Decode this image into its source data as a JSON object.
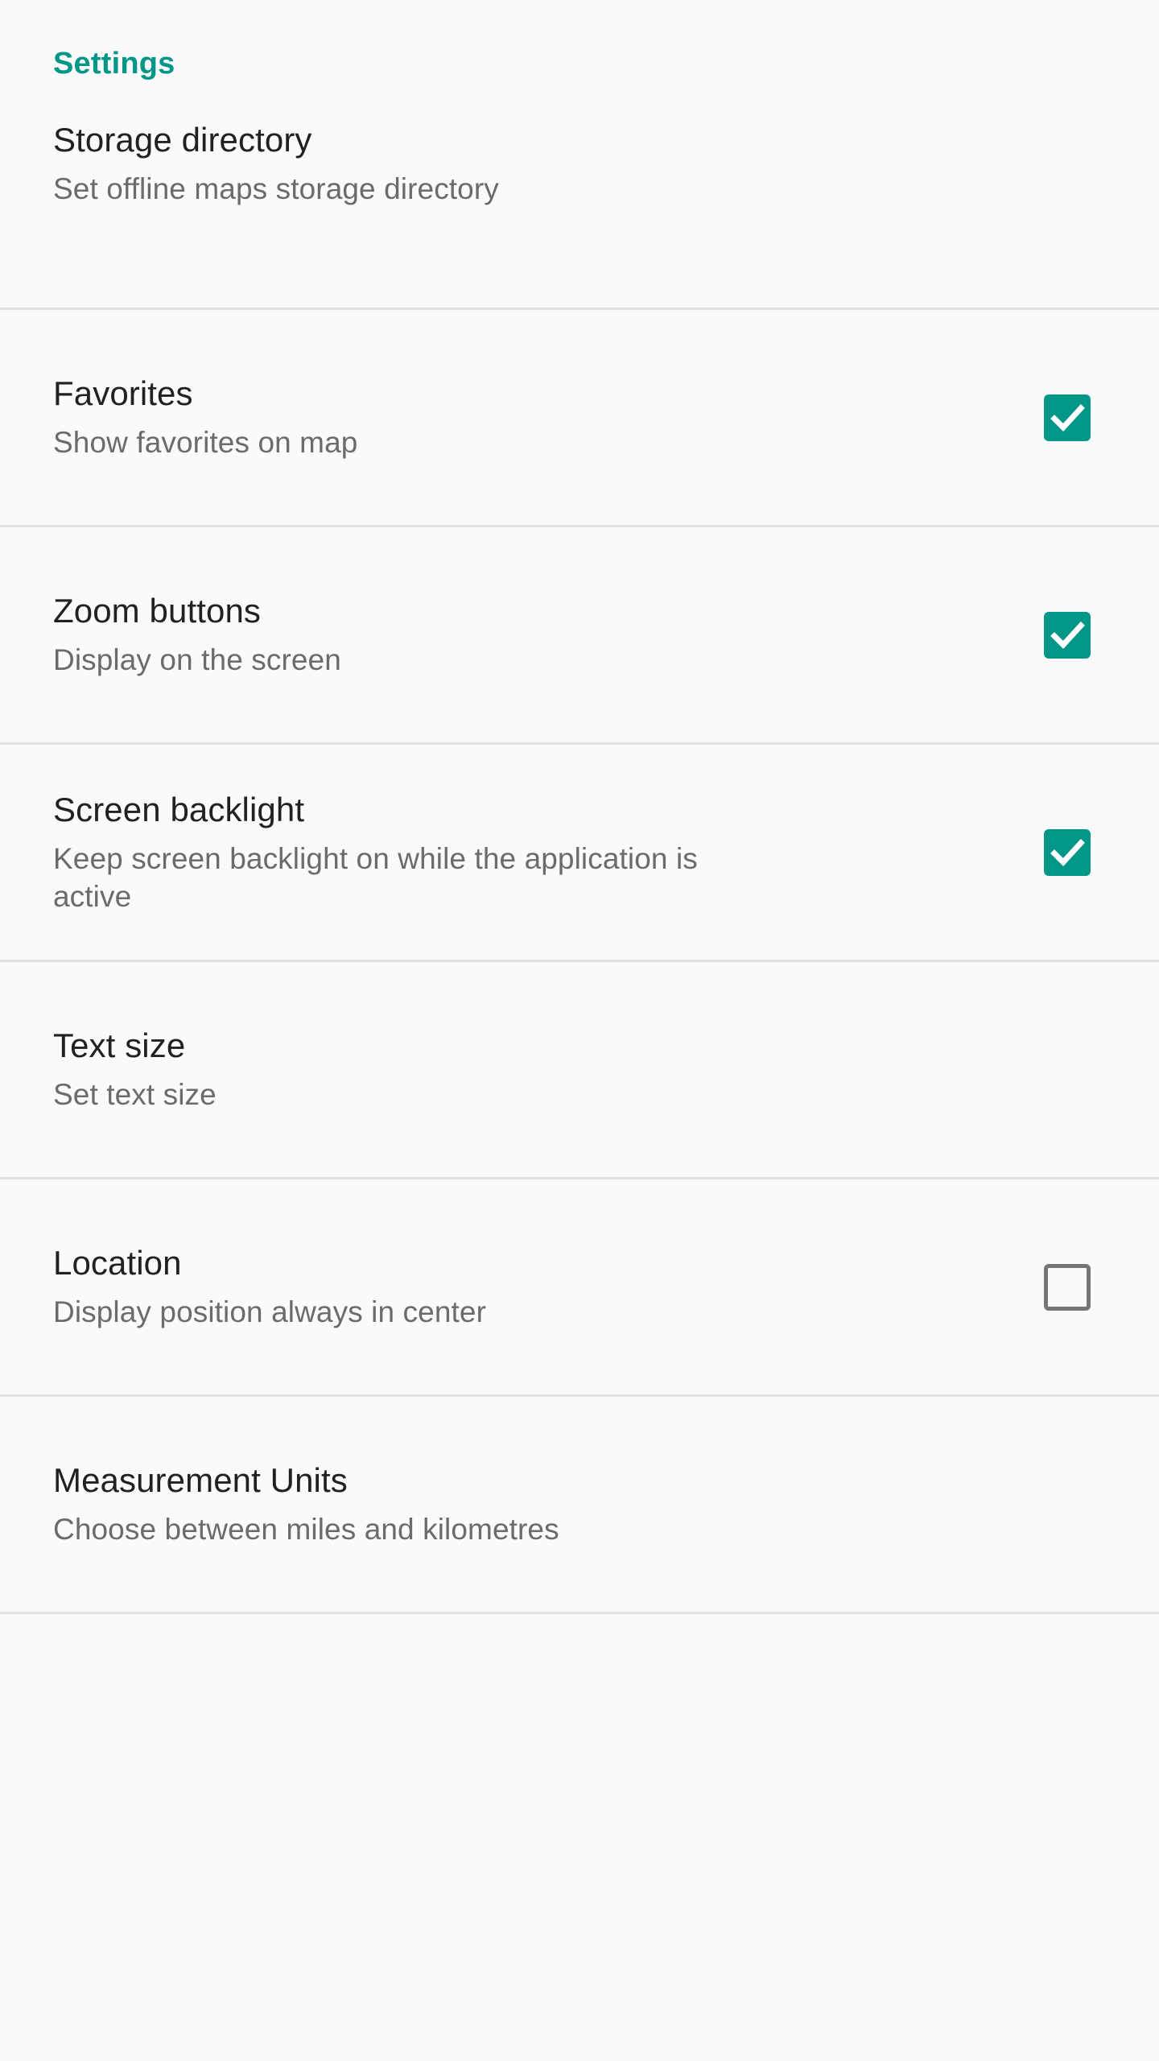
{
  "theme": {
    "accent_color": "#009688",
    "background_color": "#fafafa",
    "title_color": "#212121",
    "summary_color": "#6b6b6b",
    "divider_color": "#e0e0e0",
    "checkbox_unchecked_border": "#757575"
  },
  "header": {
    "title": "Settings"
  },
  "preferences": [
    {
      "title": "Storage directory",
      "summary": "Set offline maps storage directory",
      "widget": "none",
      "checked": null,
      "name": "storage-directory"
    },
    {
      "title": "Favorites",
      "summary": "Show favorites on map",
      "widget": "checkbox",
      "checked": true,
      "name": "favorites"
    },
    {
      "title": "Zoom buttons",
      "summary": "Display on the screen",
      "widget": "checkbox",
      "checked": true,
      "name": "zoom-buttons"
    },
    {
      "title": "Screen backlight",
      "summary": "Keep screen backlight on while the application is active",
      "widget": "checkbox",
      "checked": true,
      "name": "screen-backlight"
    },
    {
      "title": "Text size",
      "summary": "Set text size",
      "widget": "none",
      "checked": null,
      "name": "text-size"
    },
    {
      "title": "Location",
      "summary": "Display position always in center",
      "widget": "checkbox",
      "checked": false,
      "name": "location"
    },
    {
      "title": "Measurement Units",
      "summary": "Choose between miles and kilometres",
      "widget": "none",
      "checked": null,
      "name": "measurement-units"
    }
  ],
  "icons": {
    "checkmark": "check-icon"
  }
}
